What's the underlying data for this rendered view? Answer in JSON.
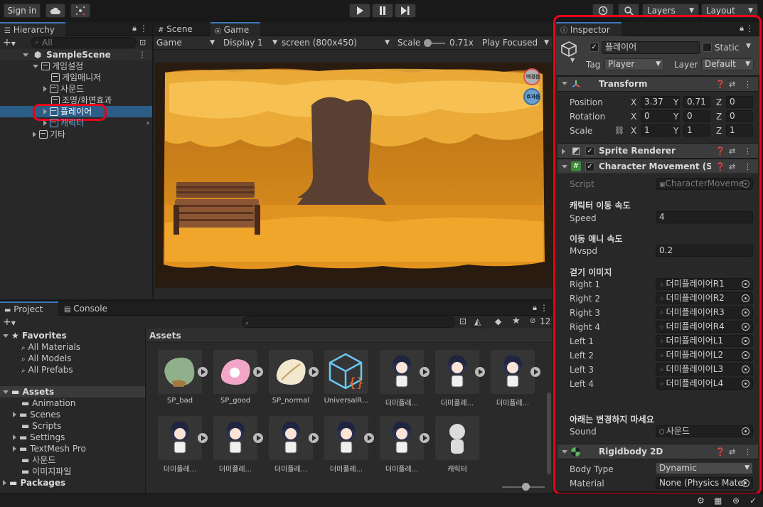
{
  "toolbar": {
    "sign_in": "Sign in",
    "layers": "Layers",
    "layout": "Layout"
  },
  "hierarchy": {
    "tab": "Hierarchy",
    "search_placeholder": "All",
    "scene": "SampleScene",
    "items": [
      {
        "label": "게임설정",
        "indent": 1
      },
      {
        "label": "게임매니저",
        "indent": 2
      },
      {
        "label": "사운드",
        "indent": 2
      },
      {
        "label": "조명/화면효과",
        "indent": 2
      },
      {
        "label": "플레이어",
        "indent": 2
      },
      {
        "label": "캐릭터",
        "indent": 2
      },
      {
        "label": "기타",
        "indent": 1
      }
    ]
  },
  "game": {
    "tab_scene": "Scene",
    "tab_game": "Game",
    "mode": "Game",
    "display": "Display 1",
    "resolution": "screen (800x450)",
    "scale_label": "Scale",
    "scale_value": "0.71x",
    "play_focused": "Play Focused",
    "btn_bgm": "배경음",
    "btn_sfx": "효과음"
  },
  "project": {
    "tab_project": "Project",
    "tab_console": "Console",
    "hidden_count": "12",
    "favorites": "Favorites",
    "fav_items": [
      "All Materials",
      "All Models",
      "All Prefabs"
    ],
    "assets": "Assets",
    "asset_folders": [
      "Animation",
      "Scenes",
      "Scripts",
      "Settings",
      "TextMesh Pro",
      "사운드",
      "이미지파일"
    ],
    "packages": "Packages",
    "grid_title": "Assets",
    "grid_items": [
      "SP_bad",
      "SP_good",
      "SP_normal",
      "UniversalR...",
      "더미플레...",
      "더미플레...",
      "더미플레...",
      "더미플레...",
      "더미플레...",
      "더미플레...",
      "더미플레...",
      "더미플레...",
      "캐릭터"
    ]
  },
  "inspector": {
    "tab": "Inspector",
    "object_name": "플레이어",
    "static": "Static",
    "tag_label": "Tag",
    "tag_value": "Player",
    "layer_label": "Layer",
    "layer_value": "Default",
    "transform": {
      "title": "Transform",
      "position_label": "Position",
      "rotation_label": "Rotation",
      "scale_label": "Scale",
      "position": {
        "x": "3.37",
        "y": "0.71",
        "z": "0"
      },
      "rotation": {
        "x": "0",
        "y": "0",
        "z": "0"
      },
      "scale": {
        "x": "1",
        "y": "1",
        "z": "1"
      }
    },
    "sprite_renderer": "Sprite Renderer",
    "character_movement": {
      "title": "Character Movement (Scrip",
      "script_label": "Script",
      "script_value": "CharacterMoveme",
      "speed_header": "캐릭터 이동 속도",
      "speed_label": "Speed",
      "speed_value": "4",
      "mvspd_header": "이동 애니 속도",
      "mvspd_label": "Mvspd",
      "mvspd_value": "0.2",
      "walk_header": "걷기 이미지",
      "walk": [
        {
          "label": "Right 1",
          "value": "더미플레이어R1"
        },
        {
          "label": "Right 2",
          "value": "더미플레이어R2"
        },
        {
          "label": "Right 3",
          "value": "더미플레이어R3"
        },
        {
          "label": "Right 4",
          "value": "더미플레이어R4"
        },
        {
          "label": "Left 1",
          "value": "더미플레이어L1"
        },
        {
          "label": "Left 2",
          "value": "더미플레이어L2"
        },
        {
          "label": "Left 3",
          "value": "더미플레이어L3"
        },
        {
          "label": "Left 4",
          "value": "더미플레이어L4"
        }
      ],
      "warn_header": "아래는 변경하지 마세요",
      "sound_label": "Sound",
      "sound_value": "사운드"
    },
    "rigidbody": {
      "title": "Rigidbody 2D",
      "body_type_label": "Body Type",
      "body_type_value": "Dynamic",
      "material_label": "Material",
      "material_value": "None (Physics Mater"
    }
  },
  "colors": {
    "selection": "#2c5d87",
    "highlight": "#e8001c",
    "accent": "#3a79bb"
  }
}
